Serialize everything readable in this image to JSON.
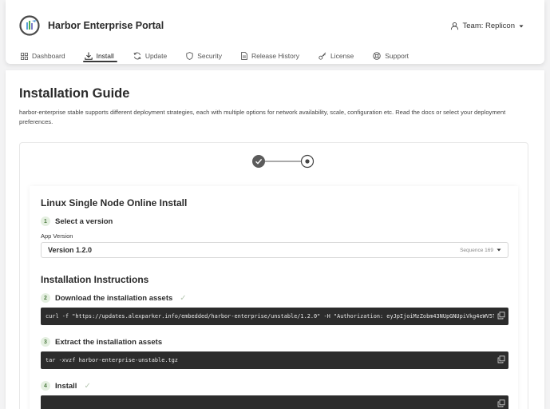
{
  "app": {
    "title": "Harbor Enterprise Portal"
  },
  "team": {
    "label": "Team: Replicon"
  },
  "tabs": [
    {
      "label": "Dashboard",
      "icon": "grid-icon"
    },
    {
      "label": "Install",
      "icon": "download-icon",
      "active": true
    },
    {
      "label": "Update",
      "icon": "refresh-icon"
    },
    {
      "label": "Security",
      "icon": "shield-icon"
    },
    {
      "label": "Release History",
      "icon": "document-icon"
    },
    {
      "label": "License",
      "icon": "key-icon"
    },
    {
      "label": "Support",
      "icon": "lifebuoy-icon"
    }
  ],
  "page": {
    "title": "Installation Guide",
    "description": "harbor-enterprise stable supports different deployment strategies, each with multiple options for network availability, scale, configuration etc. Read the docs or select your deployment preferences."
  },
  "stepper": {
    "completed": 1,
    "current": 2,
    "total": 2
  },
  "install": {
    "title": "Linux Single Node Online Install",
    "step1": {
      "num": "1",
      "title": "Select a version"
    },
    "version_label": "App Version",
    "version_value": "Version 1.2.0",
    "sequence": "Sequence 169",
    "instructions_title": "Installation Instructions",
    "step2": {
      "num": "2",
      "title": "Download the installation assets",
      "check": "✓"
    },
    "step2_code": "curl -f \"https://updates.alexparker.info/embedded/harbor-enterprise/unstable/1.2.0\" -H \"Authorization: eyJpIjoiMzZobm43NUpGNUpiVkg4eWV5TB5GbUt",
    "step3": {
      "num": "3",
      "title": "Extract the installation assets"
    },
    "step3_code": "tar -xvzf harbor-enterprise-unstable.tgz",
    "step4": {
      "num": "4",
      "title": "Install",
      "check": "✓"
    },
    "step4_code": ""
  },
  "colors": {
    "accent_dark": "#3a3a3a",
    "step_badge_bg": "#e4efe0",
    "step_badge_fg": "#4f7b43",
    "code_bg": "#2c2c2c"
  }
}
